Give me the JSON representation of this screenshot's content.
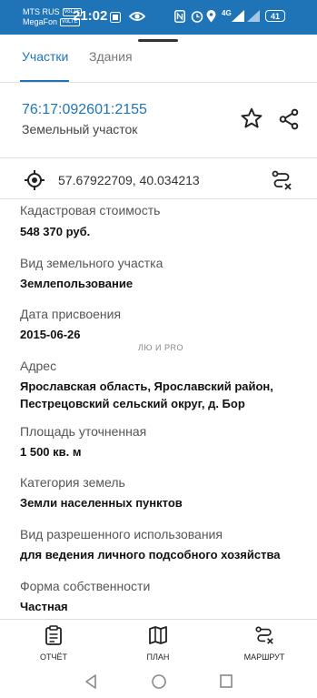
{
  "status_bar": {
    "carrier1": "MTS RUS",
    "carrier1_tag": "VoLTE",
    "carrier2": "MegaFon",
    "carrier2_tag": "VoLTE",
    "time": "21:02",
    "network": "4G",
    "battery": "41"
  },
  "tabs": [
    {
      "label": "Участки",
      "active": true
    },
    {
      "label": "Здания",
      "active": false
    }
  ],
  "header": {
    "cadastral_number": "76:17:092601:2155",
    "object_type": "Земельный участок"
  },
  "location": {
    "coordinates": "57.67922709, 40.034213"
  },
  "fields": [
    {
      "label": "Кадастровая стоимость",
      "value": "548 370 руб."
    },
    {
      "label": "Вид земельного участка",
      "value": "Землепользование"
    },
    {
      "label": "Дата присвоения",
      "value": "2015-06-26"
    },
    {
      "label": "Адрес",
      "value": "Ярославская область, Ярославский  район, Пестрецовский сельский округ, д. Бор"
    },
    {
      "label": "Площадь уточненная",
      "value": "1 500 кв. м"
    },
    {
      "label": "Категория земель",
      "value": "Земли населенных пунктов"
    },
    {
      "label": "Вид разрешенного использования",
      "value": "для ведения личного подсобного хозяйства"
    },
    {
      "label": "Форма собственности",
      "value": "Частная"
    }
  ],
  "watermark": "ЛЮ  И PRO",
  "bottom_nav": [
    {
      "label": "ОТЧЁТ",
      "icon": "clipboard-icon"
    },
    {
      "label": "ПЛАН",
      "icon": "map-icon"
    },
    {
      "label": "МАРШРУТ",
      "icon": "route-icon"
    }
  ],
  "colors": {
    "accent": "#1f74b8",
    "text": "#222222"
  }
}
